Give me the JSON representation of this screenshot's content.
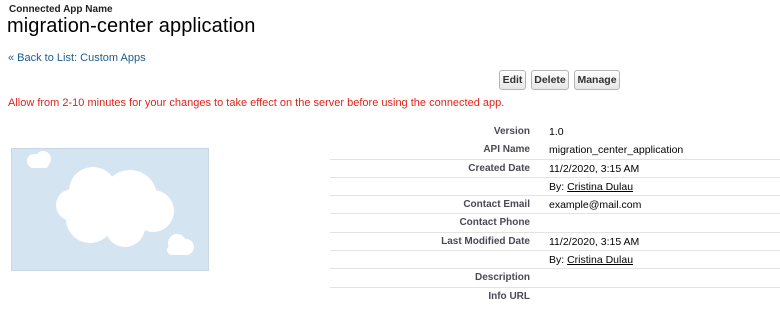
{
  "header": {
    "app_label": "Connected App Name",
    "app_title": "migration-center application",
    "back_link": "« Back to List: Custom Apps"
  },
  "toolbar": {
    "edit_label": "Edit",
    "delete_label": "Delete",
    "manage_label": "Manage"
  },
  "warning": "Allow from 2-10 minutes for your changes to take effect on the server before using the connected app.",
  "details": {
    "version_label": "Version",
    "version_value": "1.0",
    "api_name_label": "API Name",
    "api_name_value": "migration_center_application",
    "created_date_label": "Created Date",
    "created_date_value": "11/2/2020, 3:15 AM",
    "created_by_prefix": "By:",
    "created_by_user": "Cristina Dulau",
    "contact_email_label": "Contact Email",
    "contact_email_value": "example@mail.com",
    "contact_phone_label": "Contact Phone",
    "contact_phone_value": "",
    "last_modified_label": "Last Modified Date",
    "last_modified_value": "11/2/2020, 3:15 AM",
    "modified_by_prefix": "By:",
    "modified_by_user": "Cristina Dulau",
    "description_label": "Description",
    "description_value": "",
    "info_url_label": "Info URL",
    "info_url_value": ""
  },
  "colors": {
    "link": "#1b5d8c",
    "warning": "#e0241c",
    "logo_background": "#d4e4f1"
  },
  "icons": {
    "logo": "cloud-logo-icon"
  }
}
